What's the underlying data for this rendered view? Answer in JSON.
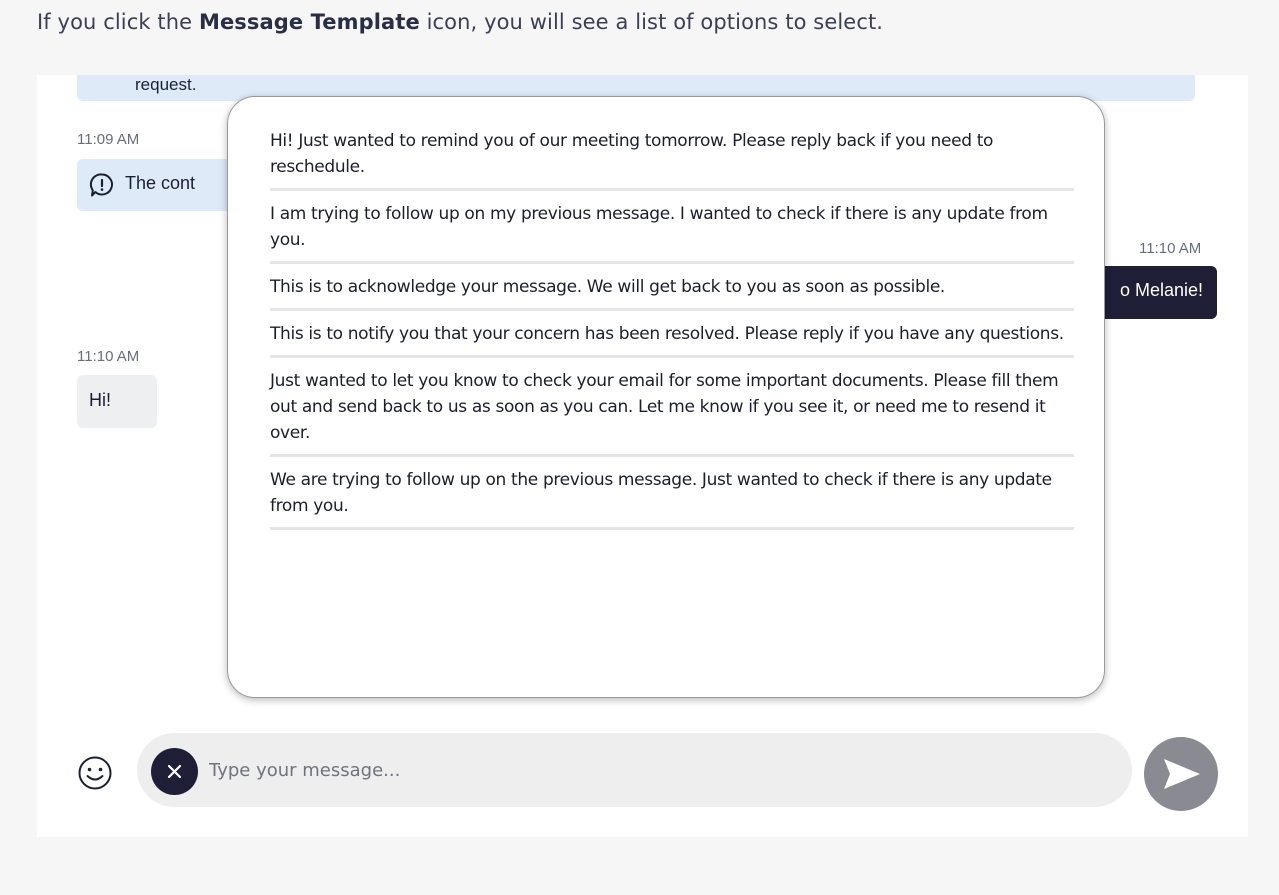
{
  "caption": {
    "prefix": "If you click the ",
    "bold": "Message Template",
    "suffix": " icon, you will see a list of options to select."
  },
  "chat": {
    "top_bubble_text": "request.",
    "info_message": {
      "time": "11:09 AM",
      "text": "The cont"
    },
    "outgoing_message": {
      "time": "11:10 AM",
      "text": "o Melanie!"
    },
    "incoming_message": {
      "time": "11:10 AM",
      "text": "Hi!"
    }
  },
  "templates": [
    "Hi! Just wanted to remind you of our meeting tomorrow. Please reply back if you need to reschedule.",
    "I am trying to follow up on my previous message. I wanted to check if there is any update from you.",
    "This is to acknowledge your message. We will get back to you as soon as possible.",
    "This is to notify you that your concern has been resolved. Please reply if you have any questions.",
    "Just wanted to let you know to check your email for some important documents. Please fill them out and send back to us as soon as you can. Let me know if you see it, or need me to resend it over.",
    "We are trying to follow up on the previous message. Just wanted to check if there is any update from you."
  ],
  "composer": {
    "placeholder": "Type your message...",
    "value": ""
  },
  "icons": {
    "info": "info-icon",
    "emoji": "smiley-icon",
    "close": "close-icon",
    "send": "send-icon"
  },
  "colors": {
    "dark_bubble": "#1e1f36",
    "light_bubble": "#dfeaf8",
    "incoming_bubble": "#eeeff1",
    "send_button": "#8a8a93"
  }
}
